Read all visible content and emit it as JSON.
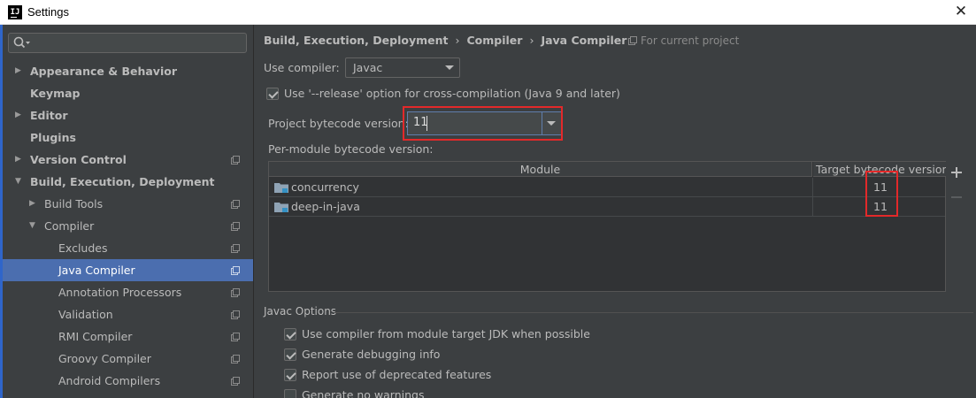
{
  "window": {
    "app_icon_text": "IJ",
    "title": "Settings",
    "close_glyph": "✕"
  },
  "sidebar": {
    "search": {
      "value": "",
      "placeholder": ""
    },
    "items": [
      {
        "label": "Appearance & Behavior",
        "arrow": "▶"
      },
      {
        "label": "Keymap"
      },
      {
        "label": "Editor",
        "arrow": "▶"
      },
      {
        "label": "Plugins"
      },
      {
        "label": "Version Control",
        "arrow": "▶"
      },
      {
        "label": "Build, Execution, Deployment",
        "arrow": "▼"
      },
      {
        "label": "Build Tools",
        "arrow": "▶"
      },
      {
        "label": "Compiler",
        "arrow": "▼"
      },
      {
        "label": "Excludes"
      },
      {
        "label": "Java Compiler",
        "selected": true
      },
      {
        "label": "Annotation Processors"
      },
      {
        "label": "Validation"
      },
      {
        "label": "RMI Compiler"
      },
      {
        "label": "Groovy Compiler"
      },
      {
        "label": "Android Compilers"
      }
    ]
  },
  "main": {
    "breadcrumb": [
      "Build, Execution, Deployment",
      "Compiler",
      "Java Compiler"
    ],
    "breadcrumb_sep": "›",
    "for_project": "For current project",
    "use_compiler": {
      "label": "Use compiler:",
      "value": "Javac"
    },
    "release_option": {
      "label": "Use '--release' option for cross-compilation (Java 9 and later)",
      "checked": true
    },
    "project_bytecode": {
      "label": "Project bytecode version:",
      "value": "11"
    },
    "per_module": {
      "label": "Per-module bytecode version:",
      "columns": [
        "Module",
        "Target bytecode version"
      ],
      "rows": [
        {
          "module": "concurrency",
          "version": "11"
        },
        {
          "module": "deep-in-java",
          "version": "11"
        }
      ]
    },
    "javac_options": {
      "title": "Javac Options",
      "items": [
        {
          "label": "Use compiler from module target JDK when possible",
          "checked": true
        },
        {
          "label": "Generate debugging info",
          "checked": true
        },
        {
          "label": "Report use of deprecated features",
          "checked": true
        },
        {
          "label": "Generate no warnings",
          "checked": false
        }
      ]
    }
  },
  "colors": {
    "highlight_red": "#e3292a",
    "selection_blue": "#4b6eaf",
    "background": "#3c3f41"
  }
}
